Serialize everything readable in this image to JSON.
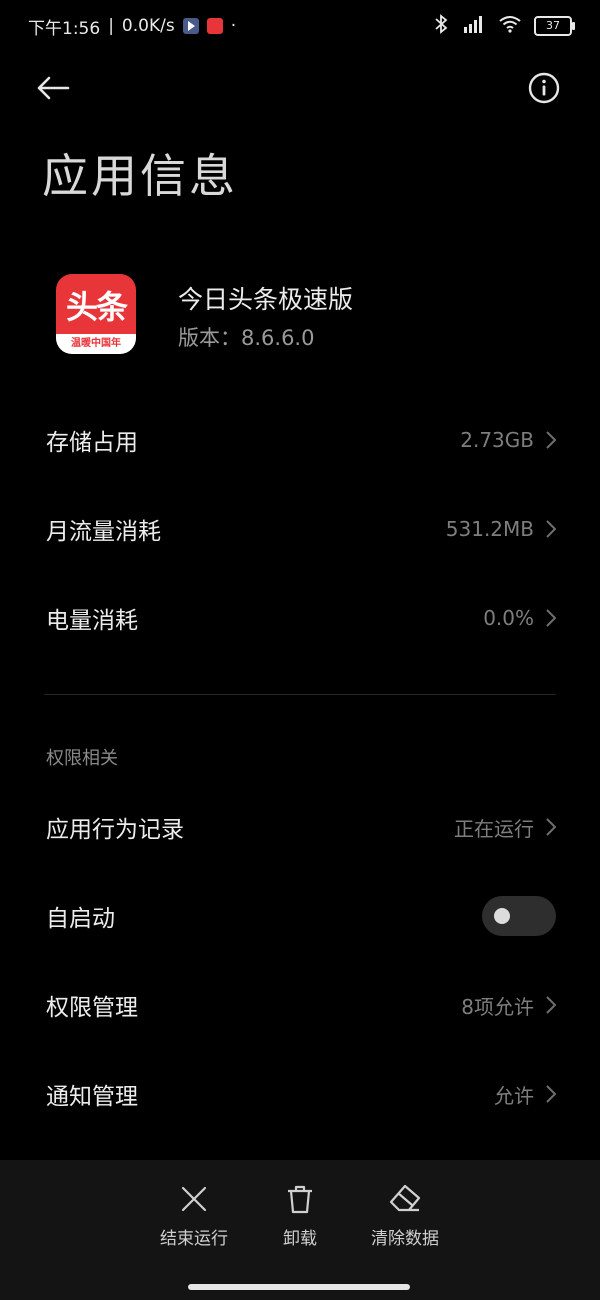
{
  "status_bar": {
    "time": "下午1:56",
    "separator": "|",
    "network_speed": "0.0K/s",
    "dot": "·",
    "battery_level": "37",
    "icons": [
      "play-store-icon",
      "app-notification-icon",
      "bluetooth-icon",
      "signal-icon",
      "wifi-icon",
      "battery-icon"
    ]
  },
  "header": {
    "back_icon": "back-arrow-icon",
    "info_icon": "info-icon",
    "title": "应用信息"
  },
  "app": {
    "icon_text": "头条",
    "icon_subtext": "温暖中国年",
    "name": "今日头条极速版",
    "version": "版本：8.6.6.0"
  },
  "rows": {
    "storage": {
      "label": "存储占用",
      "value": "2.73GB"
    },
    "data": {
      "label": "月流量消耗",
      "value": "531.2MB"
    },
    "battery": {
      "label": "电量消耗",
      "value": "0.0%"
    }
  },
  "permissions_section": {
    "title": "权限相关",
    "behavior": {
      "label": "应用行为记录",
      "value": "正在运行"
    },
    "autostart": {
      "label": "自启动",
      "toggle_on": false
    },
    "permissions": {
      "label": "权限管理",
      "value": "8项允许"
    },
    "notifications": {
      "label": "通知管理",
      "value": "允许"
    }
  },
  "bottom_actions": {
    "force_stop": "结束运行",
    "uninstall": "卸载",
    "clear_data": "清除数据"
  },
  "colors": {
    "background": "#000000",
    "accent_red": "#e8353a",
    "bottom_bar": "#141414"
  }
}
